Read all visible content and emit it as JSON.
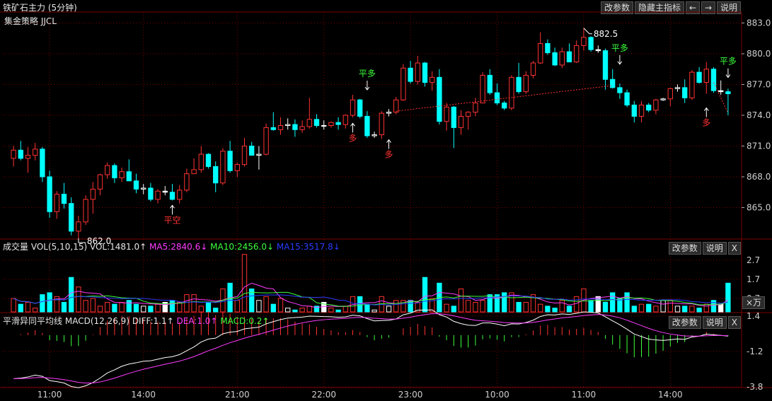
{
  "title": "铁矿石主力 (5分钟)",
  "strategy": "集金策略 JJCL",
  "top_buttons": {
    "params": "改参数",
    "hide": "隐藏主指标",
    "left": "←",
    "right": "→",
    "help": "说明"
  },
  "price_axis_labels": [
    "883.0",
    "880.0",
    "877.0",
    "874.0",
    "871.0",
    "868.0",
    "865.0"
  ],
  "vol_axis_labels": [
    "2.7",
    "1.7",
    "0.7"
  ],
  "macd_axis_labels": [
    "1.4",
    "-1.2",
    "-3.8"
  ],
  "time_labels": [
    "11:00",
    "14:00",
    "21:00",
    "22:00",
    "23:00",
    "10:00",
    "11:00",
    "14:00"
  ],
  "high_label": "882.5",
  "low_label": "862.0",
  "signals": {
    "pingkong": "平空",
    "pingduo": "平多",
    "duo": "多"
  },
  "vol_header": {
    "name": "成交量",
    "params": "VOL(5,10,15)",
    "vol": "VOL:1481.0↑",
    "ma5": "MA5:2840.6↓",
    "ma10": "MA10:2456.0↓",
    "ma15": "MA15:3517.8↓"
  },
  "macd_header": {
    "name": "平滑异同平均线",
    "params": "MACD(12,26,9)",
    "diff": "DIFF:1.1↑",
    "dea": "DEA:1.0↑",
    "macd": "MACD:0.2↑"
  },
  "pane_buttons": {
    "params": "改参数",
    "help": "说明",
    "close": "X",
    "unit": "×万"
  },
  "colors": {
    "up": "#ff3232",
    "down": "#00ffff",
    "white": "#ffffff",
    "ma5": "#ff3cff",
    "ma10": "#3cff3c",
    "ma15": "#2a3cff",
    "grid": "#7a0000",
    "signal_green": "#3cff3c",
    "signal_red": "#ff3232"
  },
  "chart_data": {
    "type": "candlestick",
    "title": "铁矿石主力 (5分钟)",
    "price_range": [
      862.0,
      884.0
    ],
    "ohlc": [
      [
        869.8,
        871.0,
        869.0,
        870.6
      ],
      [
        870.6,
        871.5,
        869.6,
        869.8
      ],
      [
        869.8,
        870.9,
        868.4,
        870.1
      ],
      [
        870.1,
        871.3,
        869.6,
        870.7
      ],
      [
        870.7,
        870.9,
        867.5,
        868.0
      ],
      [
        868.0,
        868.6,
        864.0,
        864.6
      ],
      [
        864.6,
        866.6,
        863.9,
        866.3
      ],
      [
        866.3,
        867.4,
        864.9,
        865.4
      ],
      [
        865.4,
        866.0,
        862.3,
        862.7
      ],
      [
        862.7,
        864.2,
        862.0,
        863.6
      ],
      [
        863.6,
        866.2,
        863.3,
        865.8
      ],
      [
        865.8,
        867.5,
        864.4,
        866.8
      ],
      [
        866.8,
        868.3,
        866.2,
        868.2
      ],
      [
        868.2,
        869.4,
        867.8,
        869.1
      ],
      [
        869.1,
        869.3,
        867.4,
        867.9
      ],
      [
        867.9,
        868.9,
        867.5,
        868.5
      ],
      [
        868.5,
        869.7,
        867.6,
        867.6
      ],
      [
        867.6,
        868.3,
        866.4,
        866.8
      ],
      [
        866.8,
        867.3,
        866.3,
        866.9
      ],
      [
        866.9,
        867.4,
        865.6,
        865.8
      ],
      [
        865.8,
        866.8,
        865.4,
        866.6
      ],
      [
        866.6,
        867.1,
        866.2,
        866.5
      ],
      [
        866.5,
        867.3,
        865.7,
        865.8
      ],
      [
        865.8,
        867.2,
        865.4,
        866.7
      ],
      [
        866.7,
        868.8,
        866.5,
        868.3
      ],
      [
        868.3,
        869.8,
        868.3,
        868.7
      ],
      [
        868.7,
        871.0,
        868.4,
        870.2
      ],
      [
        870.2,
        870.3,
        868.8,
        869.0
      ],
      [
        869.0,
        869.5,
        866.5,
        867.4
      ],
      [
        867.4,
        870.8,
        867.2,
        870.5
      ],
      [
        870.5,
        871.5,
        868.4,
        868.6
      ],
      [
        868.6,
        869.4,
        868.0,
        869.2
      ],
      [
        869.2,
        871.8,
        869.0,
        871.0
      ],
      [
        871.0,
        871.4,
        870.2,
        870.1
      ],
      [
        870.1,
        871.0,
        868.7,
        870.2
      ],
      [
        870.2,
        873.2,
        870.1,
        872.8
      ],
      [
        872.8,
        874.3,
        872.5,
        872.6
      ],
      [
        872.6,
        873.8,
        872.1,
        873.0
      ],
      [
        873.0,
        873.7,
        872.6,
        873.1
      ],
      [
        873.1,
        873.6,
        871.9,
        872.6
      ],
      [
        872.6,
        873.5,
        872.3,
        872.9
      ],
      [
        872.9,
        875.7,
        872.7,
        873.6
      ],
      [
        873.6,
        874.1,
        872.8,
        873.0
      ],
      [
        873.0,
        873.5,
        872.6,
        873.0
      ],
      [
        873.0,
        873.4,
        872.8,
        873.3
      ],
      [
        873.3,
        873.8,
        872.6,
        873.1
      ],
      [
        873.1,
        874.1,
        872.7,
        874.0
      ],
      [
        874.0,
        876.0,
        873.8,
        875.5
      ],
      [
        875.5,
        875.6,
        873.7,
        873.9
      ],
      [
        873.9,
        874.4,
        871.8,
        872.0
      ],
      [
        872.0,
        872.4,
        871.8,
        872.1
      ],
      [
        872.1,
        874.4,
        871.7,
        874.2
      ],
      [
        874.2,
        874.6,
        873.9,
        874.3
      ],
      [
        874.3,
        875.8,
        874.1,
        875.5
      ],
      [
        875.5,
        879.0,
        875.4,
        878.6
      ],
      [
        878.6,
        879.3,
        877.1,
        877.3
      ],
      [
        877.3,
        879.8,
        877.0,
        879.1
      ],
      [
        879.1,
        879.2,
        876.8,
        877.2
      ],
      [
        877.2,
        878.3,
        876.4,
        877.7
      ],
      [
        877.7,
        878.5,
        873.1,
        873.4
      ],
      [
        873.4,
        875.2,
        872.5,
        874.8
      ],
      [
        874.8,
        874.9,
        870.8,
        872.8
      ],
      [
        872.8,
        874.5,
        872.1,
        873.9
      ],
      [
        873.9,
        874.4,
        872.6,
        874.3
      ],
      [
        874.3,
        875.7,
        873.9,
        875.2
      ],
      [
        875.2,
        878.2,
        875.2,
        877.9
      ],
      [
        877.9,
        878.5,
        876.0,
        876.2
      ],
      [
        876.2,
        877.1,
        875.0,
        875.2
      ],
      [
        875.2,
        875.4,
        874.5,
        874.7
      ],
      [
        874.7,
        877.9,
        874.5,
        877.7
      ],
      [
        877.7,
        879.1,
        876.1,
        876.3
      ],
      [
        876.3,
        878.3,
        876.1,
        877.9
      ],
      [
        877.9,
        879.3,
        877.6,
        879.1
      ],
      [
        879.1,
        882.1,
        879.0,
        881.0
      ],
      [
        881.0,
        881.4,
        879.9,
        880.1
      ],
      [
        880.1,
        880.6,
        878.8,
        878.9
      ],
      [
        878.9,
        880.6,
        878.6,
        880.2
      ],
      [
        880.2,
        881.0,
        879.2,
        879.2
      ],
      [
        879.2,
        881.3,
        879.1,
        880.8
      ],
      [
        880.8,
        882.5,
        880.3,
        881.6
      ],
      [
        881.6,
        881.7,
        880.2,
        880.4
      ],
      [
        880.4,
        880.8,
        880.1,
        880.3
      ],
      [
        880.3,
        880.5,
        876.5,
        877.5
      ],
      [
        877.5,
        878.5,
        876.6,
        876.7
      ],
      [
        876.7,
        877.1,
        875.6,
        876.2
      ],
      [
        876.2,
        876.5,
        874.8,
        875.0
      ],
      [
        875.0,
        875.4,
        873.3,
        873.9
      ],
      [
        873.9,
        875.4,
        873.3,
        875.0
      ],
      [
        875.0,
        875.2,
        874.3,
        874.5
      ],
      [
        874.5,
        875.6,
        874.1,
        875.5
      ],
      [
        875.5,
        875.7,
        875.4,
        875.6
      ],
      [
        875.6,
        876.7,
        874.9,
        876.6
      ],
      [
        876.6,
        877.0,
        876.3,
        876.7
      ],
      [
        876.7,
        877.5,
        875.2,
        875.7
      ],
      [
        875.7,
        878.4,
        875.5,
        878.2
      ],
      [
        878.2,
        878.7,
        877.1,
        877.2
      ],
      [
        877.2,
        879.2,
        876.1,
        878.5
      ],
      [
        878.5,
        878.7,
        876.2,
        876.4
      ],
      [
        876.4,
        877.4,
        876.0,
        876.3
      ],
      [
        876.3,
        876.6,
        874.0,
        876.1
      ]
    ],
    "volume": [
      0.7,
      0.4,
      0.5,
      0.2,
      0.9,
      1.0,
      0.8,
      0.5,
      1.8,
      1.3,
      0.6,
      0.7,
      0.3,
      0.5,
      0.4,
      0.5,
      0.6,
      0.4,
      0.3,
      0.3,
      0.4,
      0.5,
      0.6,
      0.5,
      0.9,
      0.9,
      0.3,
      0.5,
      0.2,
      1.2,
      1.5,
      0.6,
      3.0,
      1.2,
      0.6,
      0.8,
      0.4,
      0.7,
      0.2,
      0.1,
      0.2,
      0.3,
      0.3,
      0.5,
      0.2,
      0.1,
      0.3,
      0.8,
      0.8,
      0.4,
      0.1,
      0.8,
      0.3,
      0.6,
      0.6,
      0.6,
      0.5,
      1.8,
      0.7,
      1.5,
      0.4,
      0.3,
      1.2,
      0.6,
      0.5,
      0.6,
      0.9,
      0.9,
      1.0,
      1.0,
      0.5,
      0.5,
      0.9,
      0.4,
      0.3,
      0.2,
      0.6,
      0.3,
      0.8,
      1.2,
      0.6,
      0.8,
      0.5,
      1.0,
      0.7,
      1.0,
      0.3,
      0.4,
      0.4,
      0.3,
      0.6,
      0.6,
      0.3,
      0.3,
      0.3,
      0.2,
      0.4,
      0.6,
      0.4,
      1.5
    ],
    "macd_range": [
      -3.8,
      1.6
    ]
  }
}
